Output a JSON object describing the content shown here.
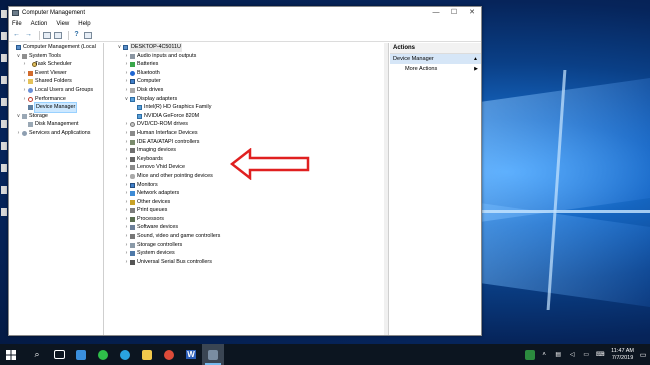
{
  "window": {
    "title": "Computer Management",
    "minimize": "—",
    "maximize": "☐",
    "close": "✕"
  },
  "menu": [
    "File",
    "Action",
    "View",
    "Help"
  ],
  "toolbar_icons": [
    "back-icon",
    "forward-icon",
    "up-folder-icon",
    "show-hide-tree-icon",
    "help-icon",
    "console-icon"
  ],
  "left_tree": [
    {
      "label": "Computer Management (Local",
      "indent": 0,
      "expander": "",
      "icon": "comp",
      "name": "computer-management-root"
    },
    {
      "label": "System Tools",
      "indent": 1,
      "expander": "∨",
      "icon": "tool",
      "name": "system-tools"
    },
    {
      "label": "Task Scheduler",
      "indent": 2,
      "expander": "›",
      "icon": "clock",
      "name": "task-scheduler"
    },
    {
      "label": "Event Viewer",
      "indent": 2,
      "expander": "›",
      "icon": "event",
      "name": "event-viewer"
    },
    {
      "label": "Shared Folders",
      "indent": 2,
      "expander": "›",
      "icon": "share",
      "name": "shared-folders"
    },
    {
      "label": "Local Users and Groups",
      "indent": 2,
      "expander": "›",
      "icon": "users",
      "name": "local-users-groups"
    },
    {
      "label": "Performance",
      "indent": 2,
      "expander": "›",
      "icon": "perf",
      "name": "performance"
    },
    {
      "label": "Device Manager",
      "indent": 2,
      "expander": "",
      "icon": "dev",
      "name": "device-manager",
      "selected": true
    },
    {
      "label": "Storage",
      "indent": 1,
      "expander": "∨",
      "icon": "disk",
      "name": "storage"
    },
    {
      "label": "Disk Management",
      "indent": 2,
      "expander": "",
      "icon": "disk",
      "name": "disk-management"
    },
    {
      "label": "Services and Applications",
      "indent": 1,
      "expander": "›",
      "icon": "svc",
      "name": "services-applications"
    }
  ],
  "device_tree": [
    {
      "label": "DESKTOP-4C5011U",
      "indent": 0,
      "expander": "∨",
      "icon": "comp",
      "name": "computer-root",
      "highlight": true
    },
    {
      "label": "Audio inputs and outputs",
      "indent": 1,
      "expander": "›",
      "icon": "audio",
      "name": "audio-inputs-outputs"
    },
    {
      "label": "Batteries",
      "indent": 1,
      "expander": "›",
      "icon": "batt",
      "name": "batteries"
    },
    {
      "label": "Bluetooth",
      "indent": 1,
      "expander": "›",
      "icon": "bt",
      "name": "bluetooth"
    },
    {
      "label": "Computer",
      "indent": 1,
      "expander": "›",
      "icon": "mon",
      "name": "computer"
    },
    {
      "label": "Disk drives",
      "indent": 1,
      "expander": "›",
      "icon": "drive",
      "name": "disk-drives"
    },
    {
      "label": "Display adapters",
      "indent": 1,
      "expander": "∨",
      "icon": "disp",
      "name": "display-adapters"
    },
    {
      "label": "Intel(R) HD Graphics Family",
      "indent": 2,
      "expander": "",
      "icon": "disp",
      "name": "intel-hd-graphics"
    },
    {
      "label": "NVIDIA GeForce 820M",
      "indent": 2,
      "expander": "",
      "icon": "disp",
      "name": "nvidia-geforce-820m"
    },
    {
      "label": "DVD/CD-ROM drives",
      "indent": 1,
      "expander": "›",
      "icon": "dvd",
      "name": "dvd-cd-rom-drives"
    },
    {
      "label": "Human Interface Devices",
      "indent": 1,
      "expander": "›",
      "icon": "hid",
      "name": "human-interface-devices"
    },
    {
      "label": "IDE ATA/ATAPI controllers",
      "indent": 1,
      "expander": "›",
      "icon": "ide",
      "name": "ide-ata-atapi-controllers"
    },
    {
      "label": "Imaging devices",
      "indent": 1,
      "expander": "›",
      "icon": "img",
      "name": "imaging-devices"
    },
    {
      "label": "Keyboards",
      "indent": 1,
      "expander": "›",
      "icon": "kbd",
      "name": "keyboards"
    },
    {
      "label": "Lenovo Vhid Device",
      "indent": 1,
      "expander": "›",
      "icon": "hid",
      "name": "lenovo-vhid-device"
    },
    {
      "label": "Mice and other pointing devices",
      "indent": 1,
      "expander": "›",
      "icon": "mouse",
      "name": "mice-pointing-devices"
    },
    {
      "label": "Monitors",
      "indent": 1,
      "expander": "›",
      "icon": "mon",
      "name": "monitors"
    },
    {
      "label": "Network adapters",
      "indent": 1,
      "expander": "›",
      "icon": "net",
      "name": "network-adapters"
    },
    {
      "label": "Other devices",
      "indent": 1,
      "expander": "›",
      "icon": "other",
      "name": "other-devices"
    },
    {
      "label": "Print queues",
      "indent": 1,
      "expander": "›",
      "icon": "print",
      "name": "print-queues"
    },
    {
      "label": "Processors",
      "indent": 1,
      "expander": "›",
      "icon": "cpu",
      "name": "processors"
    },
    {
      "label": "Software devices",
      "indent": 1,
      "expander": "›",
      "icon": "sw",
      "name": "software-devices"
    },
    {
      "label": "Sound, video and game controllers",
      "indent": 1,
      "expander": "›",
      "icon": "sound",
      "name": "sound-video-game-controllers"
    },
    {
      "label": "Storage controllers",
      "indent": 1,
      "expander": "›",
      "icon": "stor",
      "name": "storage-controllers"
    },
    {
      "label": "System devices",
      "indent": 1,
      "expander": "›",
      "icon": "sys",
      "name": "system-devices"
    },
    {
      "label": "Universal Serial Bus controllers",
      "indent": 1,
      "expander": "›",
      "icon": "usb",
      "name": "usb-controllers"
    }
  ],
  "actions": {
    "header": "Actions",
    "primary": "Device Manager",
    "primary_arrow": "▲",
    "more": "More Actions",
    "more_arrow": "▶"
  },
  "annotation": {
    "color": "#e02020",
    "points_to": "NVIDIA GeForce 820M"
  },
  "taskbar": {
    "start_icon": "windows-start-icon",
    "apps": [
      {
        "name": "search-icon",
        "glyph": "⌕",
        "color": "#ffffff"
      },
      {
        "name": "task-view-icon",
        "glyph": "",
        "color": "#ffffff"
      },
      {
        "name": "photos-app-icon",
        "glyph": "",
        "color": "#3a8fdc"
      },
      {
        "name": "whatsapp-icon",
        "glyph": "",
        "color": "#2fbf4a"
      },
      {
        "name": "telegram-icon",
        "glyph": "",
        "color": "#2aa3e0"
      },
      {
        "name": "file-explorer-icon",
        "glyph": "",
        "color": "#f2c94c"
      },
      {
        "name": "chrome-icon",
        "glyph": "",
        "color": "#dd4b39"
      },
      {
        "name": "word-icon",
        "glyph": "W",
        "color": "#2b5eb8"
      },
      {
        "name": "computer-management-taskbar-icon",
        "glyph": "",
        "color": "#7a8da2",
        "active": true
      }
    ],
    "tray_icons": [
      "defender-icon",
      "chevron-up-icon",
      "network-icon",
      "volume-icon",
      "battery-icon",
      "keyboard-icon"
    ],
    "time": "11:47 AM",
    "date": "7/7/2019"
  }
}
